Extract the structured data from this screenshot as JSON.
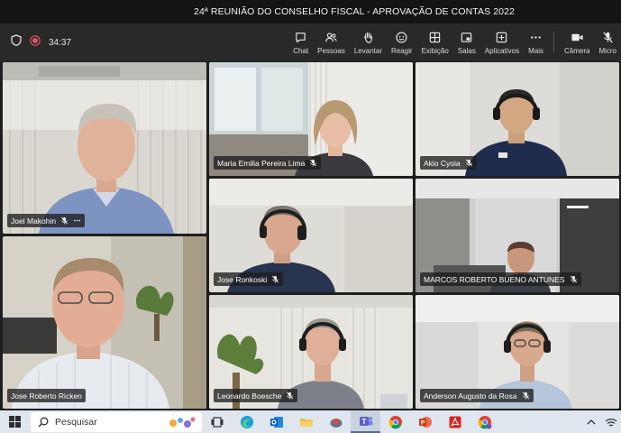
{
  "window": {
    "title": "24ª REUNIÃO DO CONSELHO FISCAL - APROVAÇÃO DE CONTAS 2022"
  },
  "meeting": {
    "timer": "34:37"
  },
  "toolbar": {
    "chat": "Chat",
    "people": "Pessoas",
    "raise": "Levantar",
    "react": "Reagir",
    "view": "Exibição",
    "rooms": "Salas",
    "apps": "Aplicativos",
    "more": "Mais",
    "camera": "Câmera",
    "mic": "Micro"
  },
  "participants": [
    {
      "name": "Joel Makohin"
    },
    {
      "name": "Maria Emilia Pereira Lima"
    },
    {
      "name": "Akio Cyoia"
    },
    {
      "name": "Jose Roberto Ricken"
    },
    {
      "name": "Jose Ronkoski"
    },
    {
      "name": "MARCOS ROBERTO BUENO ANTUNES"
    },
    {
      "name": "Leonardo Boesche"
    },
    {
      "name": "Anderson Augusto da Rosa"
    }
  ],
  "taskbar": {
    "search_placeholder": "Pesquisar"
  },
  "colors": {
    "accent": "#6a6ec9",
    "toolbar_bg": "#292929",
    "taskbar_bg": "#dfe6ee"
  }
}
